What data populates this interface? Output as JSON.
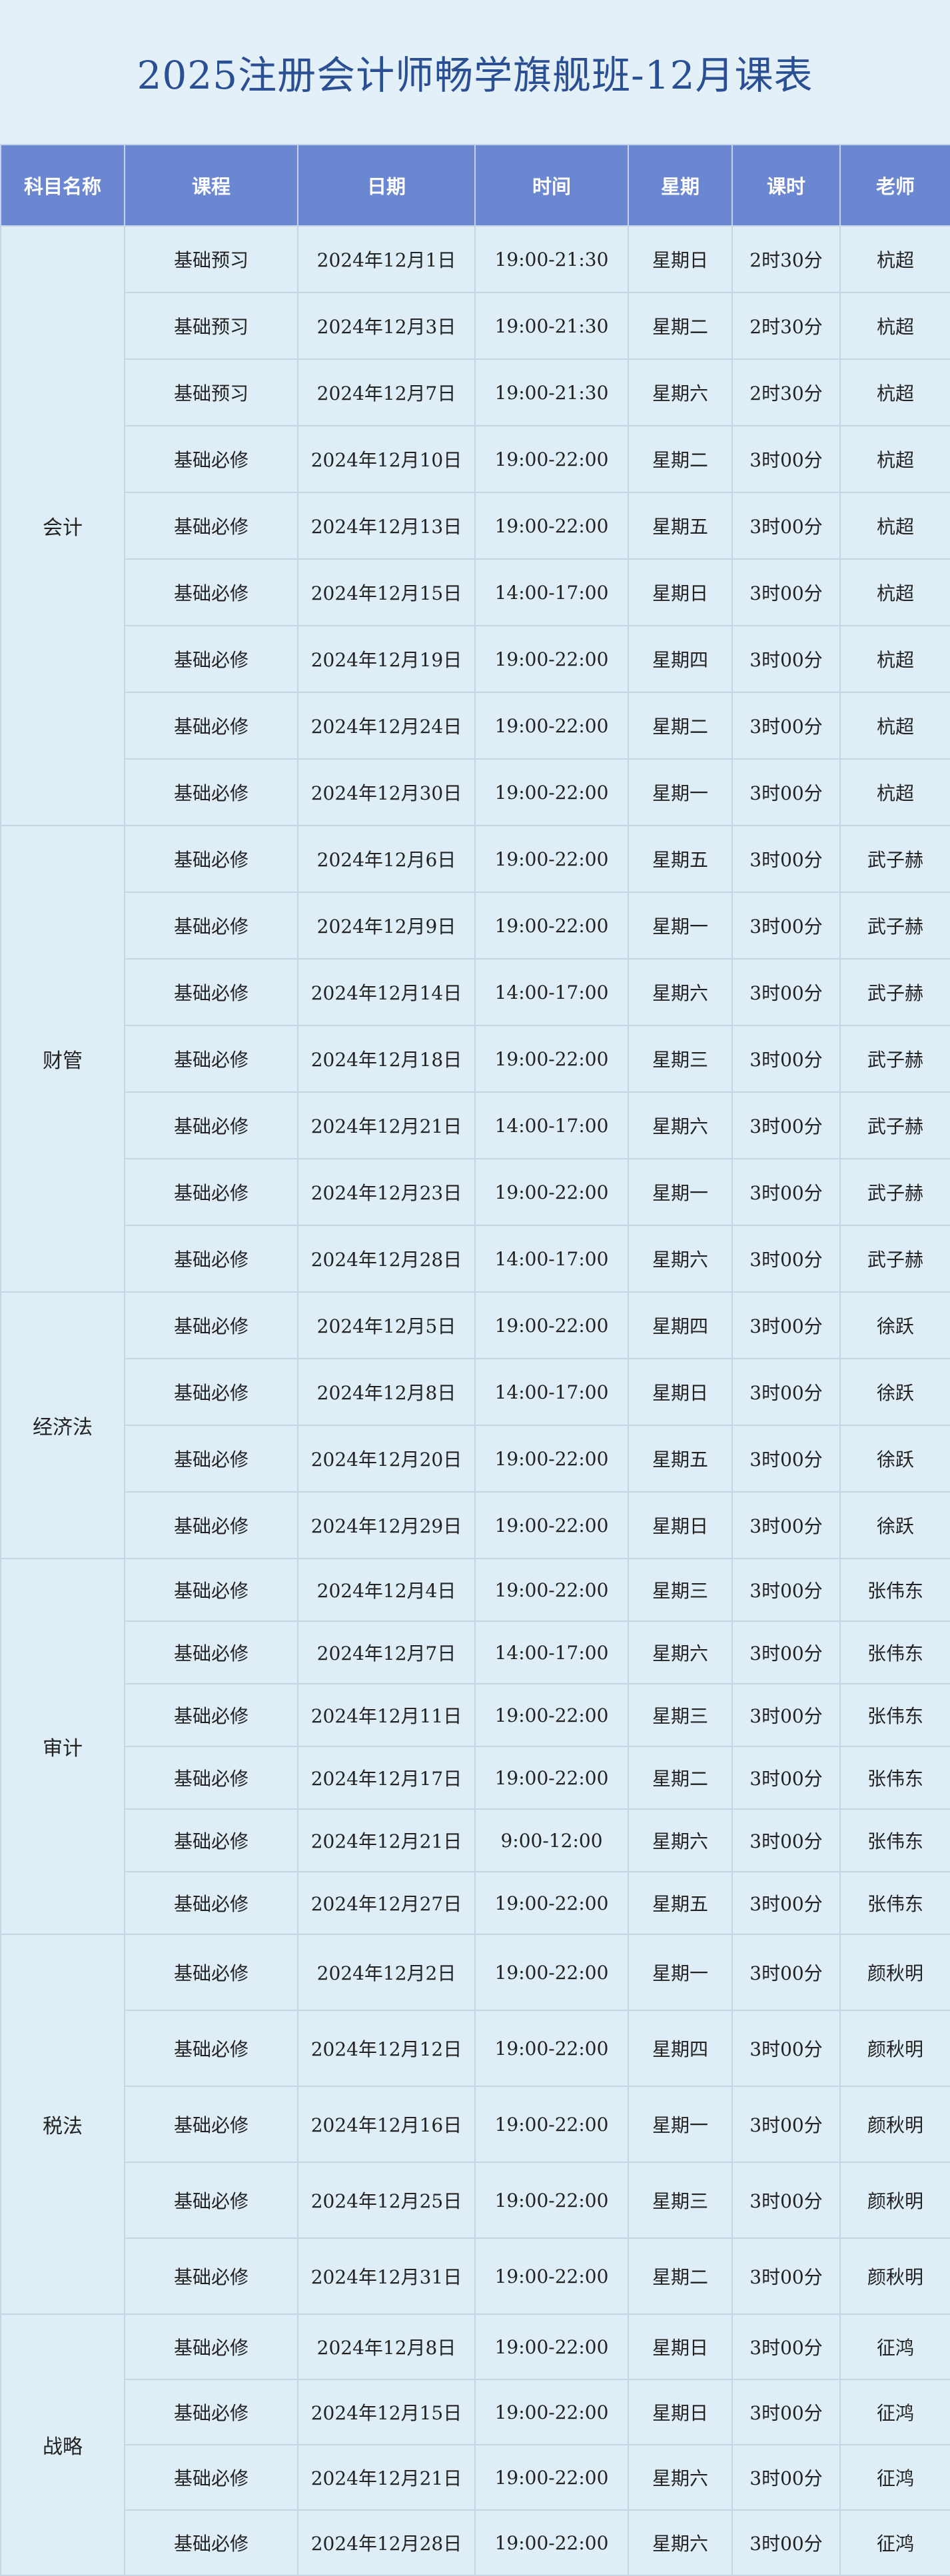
{
  "title": "2025注册会计师畅学旗舰班-12月课表",
  "headers": [
    "科目名称",
    "课程",
    "日期",
    "时间",
    "星期",
    "课时",
    "老师"
  ],
  "groups": [
    {
      "subject": "会计",
      "rows": [
        [
          "基础预习",
          "2024年12月1日",
          "19:00-21:30",
          "星期日",
          "2时30分",
          "杭超"
        ],
        [
          "基础预习",
          "2024年12月3日",
          "19:00-21:30",
          "星期二",
          "2时30分",
          "杭超"
        ],
        [
          "基础预习",
          "2024年12月7日",
          "19:00-21:30",
          "星期六",
          "2时30分",
          "杭超"
        ],
        [
          "基础必修",
          "2024年12月10日",
          "19:00-22:00",
          "星期二",
          "3时00分",
          "杭超"
        ],
        [
          "基础必修",
          "2024年12月13日",
          "19:00-22:00",
          "星期五",
          "3时00分",
          "杭超"
        ],
        [
          "基础必修",
          "2024年12月15日",
          "14:00-17:00",
          "星期日",
          "3时00分",
          "杭超"
        ],
        [
          "基础必修",
          "2024年12月19日",
          "19:00-22:00",
          "星期四",
          "3时00分",
          "杭超"
        ],
        [
          "基础必修",
          "2024年12月24日",
          "19:00-22:00",
          "星期二",
          "3时00分",
          "杭超"
        ],
        [
          "基础必修",
          "2024年12月30日",
          "19:00-22:00",
          "星期一",
          "3时00分",
          "杭超"
        ]
      ]
    },
    {
      "subject": "财管",
      "rows": [
        [
          "基础必修",
          "2024年12月6日",
          "19:00-22:00",
          "星期五",
          "3时00分",
          "武子赫"
        ],
        [
          "基础必修",
          "2024年12月9日",
          "19:00-22:00",
          "星期一",
          "3时00分",
          "武子赫"
        ],
        [
          "基础必修",
          "2024年12月14日",
          "14:00-17:00",
          "星期六",
          "3时00分",
          "武子赫"
        ],
        [
          "基础必修",
          "2024年12月18日",
          "19:00-22:00",
          "星期三",
          "3时00分",
          "武子赫"
        ],
        [
          "基础必修",
          "2024年12月21日",
          "14:00-17:00",
          "星期六",
          "3时00分",
          "武子赫"
        ],
        [
          "基础必修",
          "2024年12月23日",
          "19:00-22:00",
          "星期一",
          "3时00分",
          "武子赫"
        ],
        [
          "基础必修",
          "2024年12月28日",
          "14:00-17:00",
          "星期六",
          "3时00分",
          "武子赫"
        ]
      ]
    },
    {
      "subject": "经济法",
      "rows": [
        [
          "基础必修",
          "2024年12月5日",
          "19:00-22:00",
          "星期四",
          "3时00分",
          "徐跃"
        ],
        [
          "基础必修",
          "2024年12月8日",
          "14:00-17:00",
          "星期日",
          "3时00分",
          "徐跃"
        ],
        [
          "基础必修",
          "2024年12月20日",
          "19:00-22:00",
          "星期五",
          "3时00分",
          "徐跃"
        ],
        [
          "基础必修",
          "2024年12月29日",
          "19:00-22:00",
          "星期日",
          "3时00分",
          "徐跃"
        ]
      ]
    },
    {
      "subject": "审计",
      "rows": [
        [
          "基础必修",
          "2024年12月4日",
          "19:00-22:00",
          "星期三",
          "3时00分",
          "张伟东"
        ],
        [
          "基础必修",
          "2024年12月7日",
          "14:00-17:00",
          "星期六",
          "3时00分",
          "张伟东"
        ],
        [
          "基础必修",
          "2024年12月11日",
          "19:00-22:00",
          "星期三",
          "3时00分",
          "张伟东"
        ],
        [
          "基础必修",
          "2024年12月17日",
          "19:00-22:00",
          "星期二",
          "3时00分",
          "张伟东"
        ],
        [
          "基础必修",
          "2024年12月21日",
          "9:00-12:00",
          "星期六",
          "3时00分",
          "张伟东"
        ],
        [
          "基础必修",
          "2024年12月27日",
          "19:00-22:00",
          "星期五",
          "3时00分",
          "张伟东"
        ]
      ]
    },
    {
      "subject": "税法",
      "rows": [
        [
          "基础必修",
          "2024年12月2日",
          "19:00-22:00",
          "星期一",
          "3时00分",
          "颜秋明"
        ],
        [
          "基础必修",
          "2024年12月12日",
          "19:00-22:00",
          "星期四",
          "3时00分",
          "颜秋明"
        ],
        [
          "基础必修",
          "2024年12月16日",
          "19:00-22:00",
          "星期一",
          "3时00分",
          "颜秋明"
        ],
        [
          "基础必修",
          "2024年12月25日",
          "19:00-22:00",
          "星期三",
          "3时00分",
          "颜秋明"
        ],
        [
          "基础必修",
          "2024年12月31日",
          "19:00-22:00",
          "星期二",
          "3时00分",
          "颜秋明"
        ]
      ]
    },
    {
      "subject": "战略",
      "rows": [
        [
          "基础必修",
          "2024年12月8日",
          "19:00-22:00",
          "星期日",
          "3时00分",
          "征鸿"
        ],
        [
          "基础必修",
          "2024年12月15日",
          "19:00-22:00",
          "星期日",
          "3时00分",
          "征鸿"
        ],
        [
          "基础必修",
          "2024年12月21日",
          "19:00-22:00",
          "星期六",
          "3时00分",
          "征鸿"
        ],
        [
          "基础必修",
          "2024年12月28日",
          "19:00-22:00",
          "星期六",
          "3时00分",
          "征鸿"
        ]
      ]
    }
  ],
  "colors": {
    "title": "#2a4f93",
    "header_bg": "#6b87d2",
    "header_text": "#ffffff",
    "cell_bg": "#dfeef6",
    "page_bg": "#e4f0f7",
    "border": "#c6d5e3"
  }
}
